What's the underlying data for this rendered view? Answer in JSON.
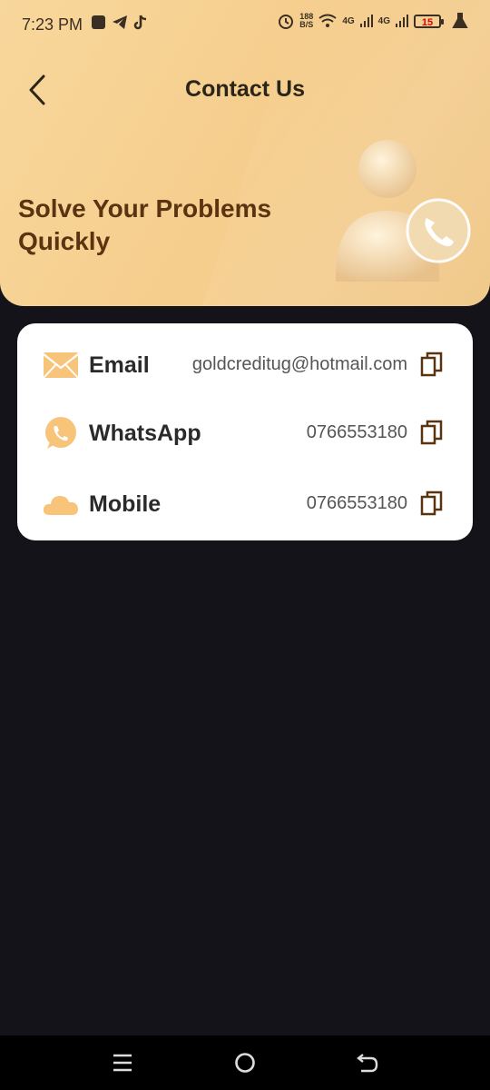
{
  "status_bar": {
    "time": "7:23 PM",
    "net_speed_value": "188",
    "net_speed_unit": "B/S",
    "signal1": "4G",
    "signal2": "4G",
    "battery": "15"
  },
  "header": {
    "title": "Contact Us",
    "headline": "Solve Your Problems Quickly"
  },
  "contacts": {
    "email": {
      "label": "Email",
      "value": "goldcreditug@hotmail.com"
    },
    "whatsapp": {
      "label": "WhatsApp",
      "value": "0766553180"
    },
    "mobile": {
      "label": "Mobile",
      "value": "0766553180"
    }
  },
  "colors": {
    "header_bg": "#f5cd8c",
    "accent": "#f7c47a",
    "headline_text": "#5a3410",
    "page_bg": "#141319"
  },
  "icons": {
    "back": "chevron-left-icon",
    "email": "envelope-icon",
    "whatsapp": "whatsapp-icon",
    "mobile": "cloud-icon",
    "copy": "copy-icon"
  }
}
